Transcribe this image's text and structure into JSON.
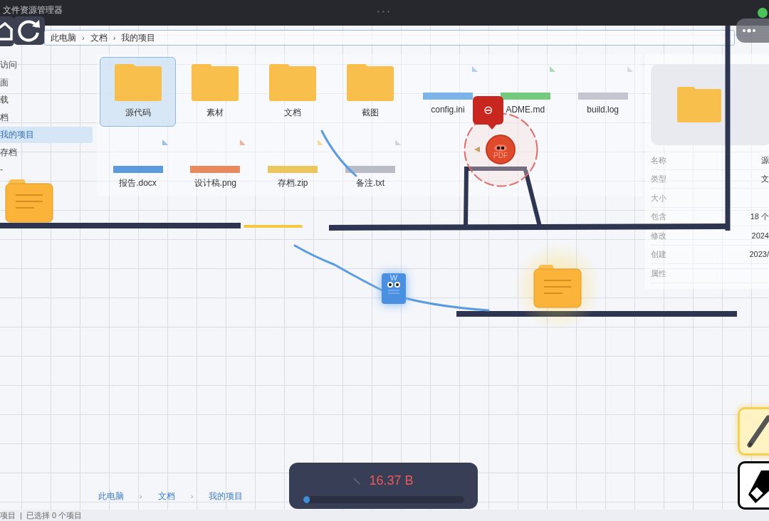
{
  "window": {
    "title": "文件资源管理器"
  },
  "address_bar": {
    "separator": "›",
    "parts": [
      "此电脑",
      "文档",
      "我的项目"
    ]
  },
  "sidebar": {
    "items": [
      {
        "label": "访问",
        "selected": false
      },
      {
        "label": "面",
        "selected": false
      },
      {
        "label": "载",
        "selected": false
      },
      {
        "label": "档",
        "selected": false
      },
      {
        "label": "我的项目",
        "selected": true
      },
      {
        "label": "存档",
        "selected": false
      },
      {
        "label": "-",
        "selected": false
      }
    ]
  },
  "files": [
    {
      "name": "源代码",
      "kind": "folder",
      "selected": true
    },
    {
      "name": "素材",
      "kind": "folder",
      "selected": false
    },
    {
      "name": "文档",
      "kind": "folder",
      "selected": false
    },
    {
      "name": "截图",
      "kind": "folder",
      "selected": false
    },
    {
      "name": "config.ini",
      "kind": "file",
      "color": "#7db4e8",
      "selected": false
    },
    {
      "name": "ADME.md",
      "kind": "file",
      "color": "#74c97e",
      "selected": false
    },
    {
      "name": "build.log",
      "kind": "file",
      "color": "#c3c5d0",
      "selected": false
    },
    {
      "name": "报告.docx",
      "kind": "file",
      "color": "#5b9bdd",
      "selected": false
    },
    {
      "name": "设计稿.png",
      "kind": "file",
      "color": "#e8895e",
      "selected": false
    },
    {
      "name": "存档.zip",
      "kind": "file",
      "color": "#ecc55c",
      "selected": false
    },
    {
      "name": "备注.txt",
      "kind": "file",
      "color": "#b9bbc6",
      "selected": false
    }
  ],
  "details": {
    "rows": [
      {
        "label": "名称",
        "value": "源"
      },
      {
        "label": "类型",
        "value": "文"
      },
      {
        "label": "大小"
      },
      {
        "label": "包含",
        "value": "18 个"
      },
      {
        "label": "修改",
        "value": "2024"
      },
      {
        "label": "创建",
        "value": "2023/"
      },
      {
        "label": "属性"
      }
    ]
  },
  "game": {
    "word_label": "W",
    "pdf_label": "PDF",
    "bubble": "⊖"
  },
  "bottom_breadcrumb": {
    "separator": "›",
    "parts": [
      "此电脑",
      "文档",
      "我的项目"
    ]
  },
  "status_bar": [
    "项目",
    "|",
    "已选择 0 个项目"
  ],
  "hud": {
    "reading": "16.37 B",
    "level": 0.04
  },
  "tools": [
    {
      "kind": "pencil",
      "selected": true
    },
    {
      "kind": "eraser",
      "selected": false
    }
  ]
}
